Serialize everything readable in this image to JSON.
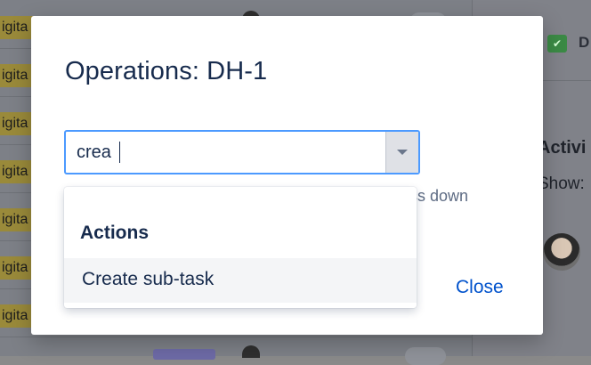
{
  "background": {
    "tag_text": "igita",
    "right_panel": {
      "check_icon": "checkbox-icon",
      "d_text": "D",
      "activity_label": "Activi",
      "show_label": "Show:"
    }
  },
  "modal": {
    "title": "Operations: DH-1",
    "search": {
      "value": "crea",
      "placeholder": ""
    },
    "hint_text": "ess down",
    "close_label": "Close"
  },
  "dropdown": {
    "group_heading": "Actions",
    "items": [
      {
        "label": "Create sub-task"
      }
    ]
  },
  "colors": {
    "accent": "#0052cc",
    "focus_border": "#4c9aff",
    "text": "#172b4d"
  }
}
